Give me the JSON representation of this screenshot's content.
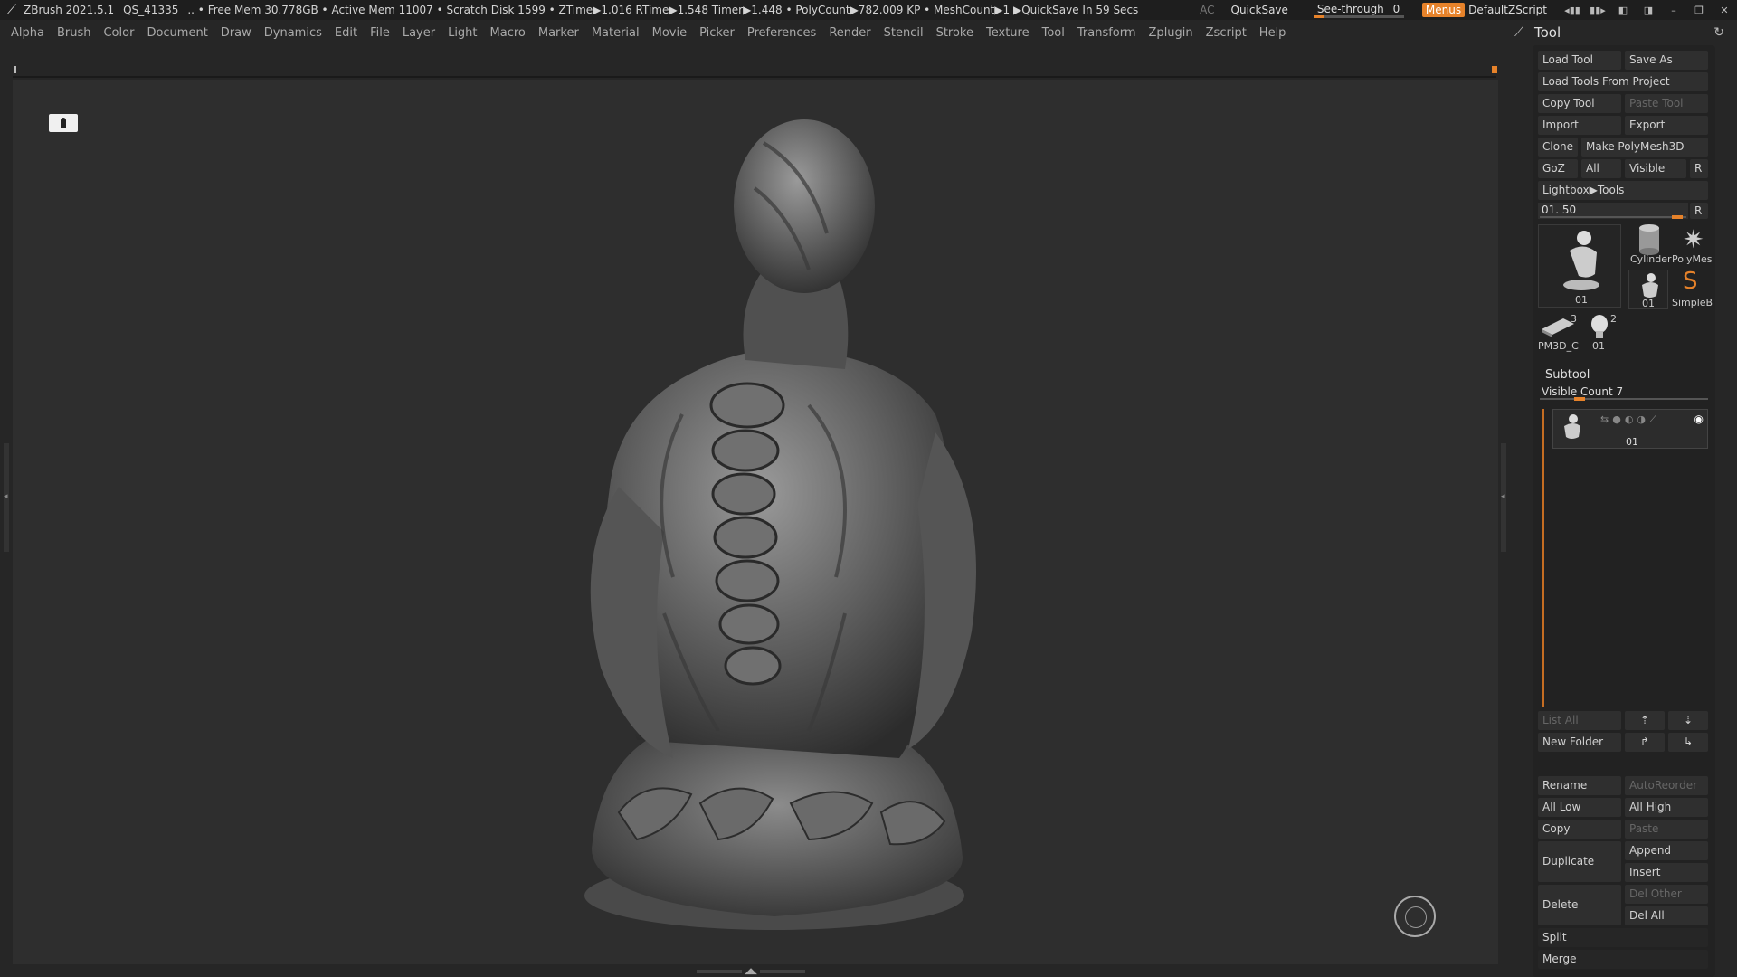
{
  "titlebar": {
    "app": "ZBrush 2021.5.1",
    "session": "QS_41335",
    "stats": ".. • Free Mem 30.778GB • Active Mem 11007 • Scratch Disk 1599 •  ZTime▶1.016 RTime▶1.548 Timer▶1.448 • PolyCount▶782.009 KP  • MeshCount▶1  ▶QuickSave In 59 Secs",
    "ac": "AC",
    "quicksave": "QuickSave",
    "seethrough_label": "See-through",
    "seethrough_value": "0",
    "menus": "Menus",
    "script": "DefaultZScript"
  },
  "menubar": {
    "items": [
      "Alpha",
      "Brush",
      "Color",
      "Document",
      "Draw",
      "Dynamics",
      "Edit",
      "File",
      "Layer",
      "Light",
      "Macro",
      "Marker",
      "Material",
      "Movie",
      "Picker",
      "Preferences",
      "Render",
      "Stencil",
      "Stroke",
      "Texture",
      "Tool",
      "Transform",
      "Zplugin",
      "Zscript",
      "Help"
    ]
  },
  "tool_panel": {
    "title": "Tool",
    "load_tool": "Load Tool",
    "save_as": "Save As",
    "load_from_project": "Load Tools From Project",
    "copy_tool": "Copy Tool",
    "paste_tool": "Paste Tool",
    "import": "Import",
    "export": "Export",
    "clone": "Clone",
    "make_polymesh": "Make PolyMesh3D",
    "goz": "GoZ",
    "all": "All",
    "visible": "Visible",
    "r": "R",
    "lightbox": "Lightbox▶Tools",
    "tool_slider_label": "01. 50",
    "tool_slider_value": 50,
    "thumbs": {
      "main": "01",
      "cylinder": "Cylinder",
      "polymesh": "PolyMes",
      "small01": "01",
      "simpleb": "SimpleB",
      "pm3d": "PM3D_C",
      "pm3d_count": "3",
      "head": "01",
      "head_count": "2"
    }
  },
  "subtool": {
    "title": "Subtool",
    "visible_count": "Visible Count 7",
    "item_name": "01",
    "list_all": "List All",
    "new_folder": "New Folder",
    "rename": "Rename",
    "autoreorder": "AutoReorder",
    "all_low": "All Low",
    "all_high": "All High",
    "copy": "Copy",
    "paste": "Paste",
    "duplicate": "Duplicate",
    "append": "Append",
    "insert": "Insert",
    "delete": "Delete",
    "del_other": "Del Other",
    "del_all": "Del All",
    "split": "Split",
    "merge": "Merge"
  },
  "colors": {
    "accent": "#e6822a",
    "background": "#2e2e2e",
    "panel": "#222222"
  }
}
